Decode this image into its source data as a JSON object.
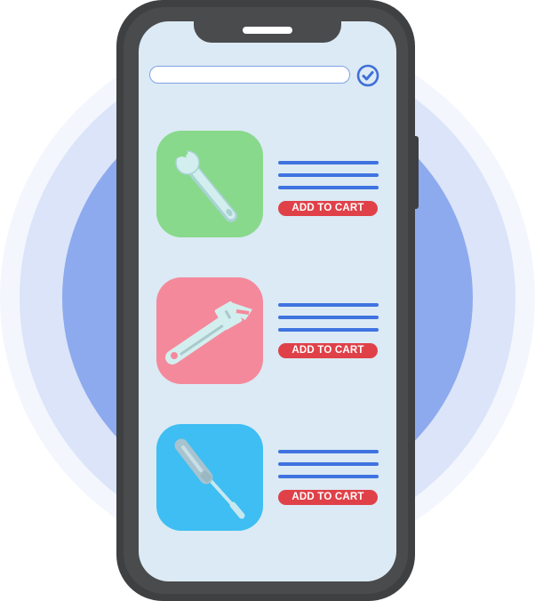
{
  "colors": {
    "background_ring_outer": "#f3f6fd",
    "background_ring_mid": "#dbe4f9",
    "background_ring_inner": "#8daaee",
    "phone_body": "#4a4b4d",
    "screen": "#dbeaf4",
    "text_line": "#3f73e0",
    "cart_button": "#e04149",
    "check_icon": "#3f6fd8"
  },
  "screen": {
    "search": {
      "value": "",
      "placeholder": ""
    },
    "confirm_icon": "check-circle-icon"
  },
  "products": [
    {
      "icon": "wrench-icon",
      "tile_color": "#88d98b",
      "button_label": "ADD TO CART"
    },
    {
      "icon": "adjustable-wrench-icon",
      "tile_color": "#f5899c",
      "button_label": "ADD TO CART"
    },
    {
      "icon": "screwdriver-icon",
      "tile_color": "#3ebef3",
      "button_label": "ADD TO CART"
    }
  ]
}
